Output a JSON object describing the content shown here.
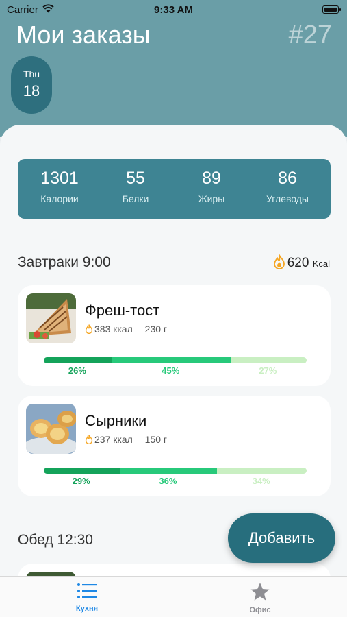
{
  "status_bar": {
    "carrier": "Carrier",
    "time": "9:33 AM"
  },
  "header": {
    "title": "Мои заказы",
    "order_number": "#27"
  },
  "date": {
    "weekday": "Thu",
    "day": "18"
  },
  "nutrition_summary": [
    {
      "value": "1301",
      "label": "Калории"
    },
    {
      "value": "55",
      "label": "Белки"
    },
    {
      "value": "89",
      "label": "Жиры"
    },
    {
      "value": "86",
      "label": "Углеводы"
    }
  ],
  "meals": [
    {
      "title": "Завтраки 9:00",
      "kcal": "620",
      "kcal_unit": "Kcal",
      "items": [
        {
          "name": "Фреш-тост",
          "kcal": "383 ккал",
          "weight": "230 г",
          "image": "toast-sandwich-photo",
          "macros": [
            {
              "label": "26%",
              "percent": 26,
              "color": "#14a35a"
            },
            {
              "label": "45%",
              "percent": 45,
              "color": "#27c97a"
            },
            {
              "label": "27%",
              "percent": 29,
              "color": "#c9efc2"
            }
          ]
        },
        {
          "name": "Сырники",
          "kcal": "237 ккал",
          "weight": "150 г",
          "image": "syrniki-photo",
          "macros": [
            {
              "label": "29%",
              "percent": 29,
              "color": "#14a35a"
            },
            {
              "label": "36%",
              "percent": 37,
              "color": "#27c97a"
            },
            {
              "label": "34%",
              "percent": 34,
              "color": "#c9efc2"
            }
          ]
        }
      ]
    },
    {
      "title": "Обед 12:30"
    }
  ],
  "add_button": {
    "label": "Добавить"
  },
  "tabs": [
    {
      "label": "Кухня",
      "icon": "list-icon",
      "active": true
    },
    {
      "label": "Офис",
      "icon": "star-icon",
      "active": false
    }
  ],
  "colors": {
    "header_bg": "#6a9ea7",
    "accent": "#276e7d",
    "tab_active": "#1e88e5",
    "tab_inactive": "#8e8e93",
    "flame": "#f5a623"
  }
}
